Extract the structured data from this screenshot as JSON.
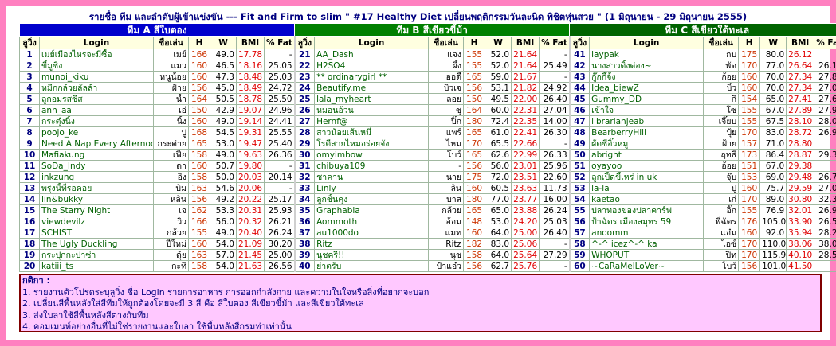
{
  "title": "รายชื่อ ทีม และลำดับผู้เข้าแข่งขัน --- Fit and Firm to slim \" #17 Healthy Diet เปลี่ยนพฤติกรรมวันละนิด พิชิตหุ่นสวย \" (1 มิถุนายน - 29 มิถุนายน 2555)",
  "colors": {
    "team_a": "#0000cc",
    "team_b": "#008000",
    "team_c": "#006400",
    "page_bg": "#ff80c0"
  },
  "headers": [
    "ลูวิ่ง",
    "Login",
    "ชื่อเล่น",
    "H",
    "W",
    "BMI",
    "% Fat"
  ],
  "teams": [
    {
      "name": "ทีม A สีใบตอง",
      "rows": [
        [
          "1",
          "เมย์เมืองไหรจะมีซื้อ",
          "เมย์",
          "166",
          "49.0",
          "17.78",
          "-"
        ],
        [
          "2",
          "ขี้มูซิง",
          "แมว",
          "160",
          "46.5",
          "18.16",
          "25.05"
        ],
        [
          "3",
          "munoi_kiku",
          "หนูน้อย",
          "160",
          "47.3",
          "18.48",
          "25.03"
        ],
        [
          "4",
          "หมีกกล้วยลัลล้า",
          "ฝ้าย",
          "156",
          "45.0",
          "18.49",
          "24.72"
        ],
        [
          "5",
          "ลูกอมรสซีส",
          "น้ำ",
          "164",
          "50.5",
          "18.78",
          "25.50"
        ],
        [
          "6",
          "ann_aa",
          "เอ๋",
          "150",
          "42.9",
          "19.07",
          "24.96"
        ],
        [
          "7",
          "กระตุ๋งนิ้ง",
          "นิ้ง",
          "160",
          "49.0",
          "19.14",
          "24.41"
        ],
        [
          "8",
          "poojo_ke",
          "ปู",
          "168",
          "54.5",
          "19.31",
          "25.55"
        ],
        [
          "9",
          "Need A Nap Every Afternoon",
          "กระต่าย",
          "165",
          "53.0",
          "19.47",
          "25.40"
        ],
        [
          "10",
          "Mafiakung",
          "เฟีย",
          "158",
          "49.0",
          "19.63",
          "26.36"
        ],
        [
          "11",
          "SoDa_Indy",
          "ดา",
          "160",
          "50.7",
          "19.80",
          "-"
        ],
        [
          "12",
          "inkzung",
          "อิง",
          "158",
          "50.0",
          "20.03",
          "20.14"
        ],
        [
          "13",
          "พรุ่งนี้ที่รอคอย",
          "บิม",
          "163",
          "54.6",
          "20.06",
          "-"
        ],
        [
          "14",
          "lin&bukky",
          "หลิน",
          "156",
          "49.2",
          "20.22",
          "25.17"
        ],
        [
          "15",
          "The Starry Night",
          "เจ",
          "162",
          "53.3",
          "20.31",
          "25.93"
        ],
        [
          "16",
          "viewdevilz",
          "วิว",
          "166",
          "56.0",
          "20.32",
          "26.21"
        ],
        [
          "17",
          "SCHIST",
          "กล้วย",
          "155",
          "49.0",
          "20.40",
          "26.24"
        ],
        [
          "18",
          "The Ugly Duckling",
          "ปีใหม่",
          "160",
          "54.0",
          "21.09",
          "30.20"
        ],
        [
          "19",
          "กระปุกกะปาซ่า",
          "ตุ้ย",
          "163",
          "57.0",
          "21.45",
          "25.00"
        ],
        [
          "20",
          "katiii_ts",
          "กะทิ",
          "158",
          "54.0",
          "21.63",
          "26.56"
        ]
      ]
    },
    {
      "name": "ทีม B สีเขียวขี้ม้า",
      "rows": [
        [
          "21",
          "AA_Dash",
          "แจง",
          "155",
          "52.0",
          "21.64",
          "-"
        ],
        [
          "22",
          "H2SO4",
          "ผึ้ง",
          "155",
          "52.0",
          "21.64",
          "25.49"
        ],
        [
          "23",
          "** ordinarygirl **",
          "ออดี้",
          "165",
          "59.0",
          "21.67",
          "-"
        ],
        [
          "24",
          "Beautify.me",
          "บิวเจ",
          "156",
          "53.1",
          "21.82",
          "24.92"
        ],
        [
          "25",
          "lala_myheart",
          "ลอย",
          "150",
          "49.5",
          "22.00",
          "26.40"
        ],
        [
          "26",
          "หมอนอ้วน",
          "ชุ",
          "164",
          "60.0",
          "22.31",
          "27.04"
        ],
        [
          "27",
          "Hernf@",
          "ปิ๊ก",
          "180",
          "72.4",
          "22.35",
          "14.00"
        ],
        [
          "28",
          "สาวน้อยเส้นหมี่",
          "แพร์",
          "165",
          "61.0",
          "22.41",
          "26.30"
        ],
        [
          "29",
          "โรตีสายไหมอร่อยจัง",
          "ไหม",
          "170",
          "65.5",
          "22.66",
          "-"
        ],
        [
          "30",
          "omyimbow",
          "โบว์",
          "165",
          "62.6",
          "22.99",
          "26.33"
        ],
        [
          "31",
          "chibuya109",
          "-",
          "156",
          "56.0",
          "23.01",
          "25.96"
        ],
        [
          "32",
          "ชาคาน",
          "นาย",
          "175",
          "72.0",
          "23.51",
          "22.60"
        ],
        [
          "33",
          "Linly",
          "ลิน",
          "160",
          "60.5",
          "23.63",
          "11.73"
        ],
        [
          "34",
          "ลูกชิ้นคุง",
          "บาส",
          "180",
          "77.0",
          "23.77",
          "16.00"
        ],
        [
          "35",
          "Graphabia",
          "กล้วย",
          "165",
          "65.0",
          "23.88",
          "26.24"
        ],
        [
          "36",
          "Aommoth",
          "อ้อม",
          "148",
          "53.0",
          "24.20",
          "25.03"
        ],
        [
          "37",
          "au1000do",
          "แมท",
          "160",
          "64.0",
          "25.00",
          "26.40"
        ],
        [
          "38",
          "Ritz",
          "Ritz",
          "182",
          "83.0",
          "25.06",
          "-"
        ],
        [
          "39",
          "นุชครี!!",
          "นุช",
          "158",
          "64.0",
          "25.64",
          "27.29"
        ],
        [
          "40",
          "ย่าตรับ",
          "ป้าแอ๋ว",
          "156",
          "62.7",
          "25.76",
          "-"
        ]
      ]
    },
    {
      "name": "ทีม C สีเขียวใต้ทะเล",
      "rows": [
        [
          "41",
          "laypak",
          "กบ",
          "175",
          "80.0",
          "26.12",
          "-"
        ],
        [
          "42",
          "นางสาวดิ้งด่อง~",
          "พัด",
          "170",
          "77.0",
          "26.64",
          "26.19"
        ],
        [
          "43",
          "กู๊กกี๊จ้ง",
          "ก้อย",
          "160",
          "70.0",
          "27.34",
          "27.84"
        ],
        [
          "44",
          "Idea_biewZ",
          "บิ๋ว",
          "160",
          "70.0",
          "27.34",
          "27.07"
        ],
        [
          "45",
          "Gummy_DD",
          "กิ",
          "154",
          "65.0",
          "27.41",
          "27.64"
        ],
        [
          "46",
          "เข้าใจ",
          "โซ",
          "155",
          "67.0",
          "27.89",
          "27.97"
        ],
        [
          "47",
          "librarianjeab",
          "เจี๊ยบ",
          "155",
          "67.5",
          "28.10",
          "28.05"
        ],
        [
          "48",
          "BearberryHill",
          "ปุ้ย",
          "170",
          "83.0",
          "28.72",
          "26.94"
        ],
        [
          "49",
          "ผัดซีอิ๊วหมู",
          "ฝ้าย",
          "157",
          "71.0",
          "28.80",
          "-"
        ],
        [
          "50",
          "abright",
          "ฤทธิ์",
          "173",
          "86.4",
          "28.87",
          "29.38"
        ],
        [
          "51",
          "oyayoo",
          "อ้อย",
          "151",
          "67.0",
          "29.38",
          "-"
        ],
        [
          "52",
          "ลูกเปิ้ดขี้เหร่ in uk",
          "จุ๊บ",
          "153",
          "69.0",
          "29.48",
          "26.79"
        ],
        [
          "53",
          "la-la",
          "ปู",
          "160",
          "75.7",
          "29.59",
          "27.00"
        ],
        [
          "54",
          "kaetao",
          "เก๋",
          "170",
          "89.0",
          "30.80",
          "32.35"
        ],
        [
          "55",
          "ปลาทองของปลาคาร์ฟ",
          "อิ๊ก",
          "155",
          "76.9",
          "32.01",
          "26.99"
        ],
        [
          "56",
          "ป้าฉัตร เมืองสมุทร 59",
          "พี่ฉัตร",
          "176",
          "105.0",
          "33.90",
          "26.53"
        ],
        [
          "57",
          "anoomm",
          "แอ๋ม",
          "160",
          "92.0",
          "35.94",
          "28.25"
        ],
        [
          "58",
          "^-^ icez^-^ ka",
          "ไอซ์",
          "170",
          "110.0",
          "38.06",
          "38.06"
        ],
        [
          "59",
          "WHOPUT",
          "ปิท",
          "170",
          "115.9",
          "40.10",
          "28.57"
        ],
        [
          "60",
          "~CaRaMelLoVer~",
          "โบว์",
          "156",
          "101.0",
          "41.50",
          "-"
        ]
      ]
    }
  ],
  "notes": {
    "caption": "กติกา :",
    "lines": [
      "1. รายงานตัวโปรดระบุลูวิ่ง ชื่อ Login รายการอาหาร การออกกำลังกาย และความในใจหรือสิ่งที่อยากจะบอก",
      "2. เปลี่ยนสีพื้นหลังใส่สีทีมให้ถูกต้องโดยจะมี 3 สี คือ สีใบตอง สีเขียวขี้ม้า และสีเขียวใต้ทะเล",
      "3. ส่งใบลาใช้สีพื้นหลังสีต่างกับทีม",
      "4. คอมเมนท์อย่างอื่นที่ไม่ใช่รายงานและใบลา ใช้พื้นหลังสีกรมท่าเท่านั้น"
    ]
  }
}
